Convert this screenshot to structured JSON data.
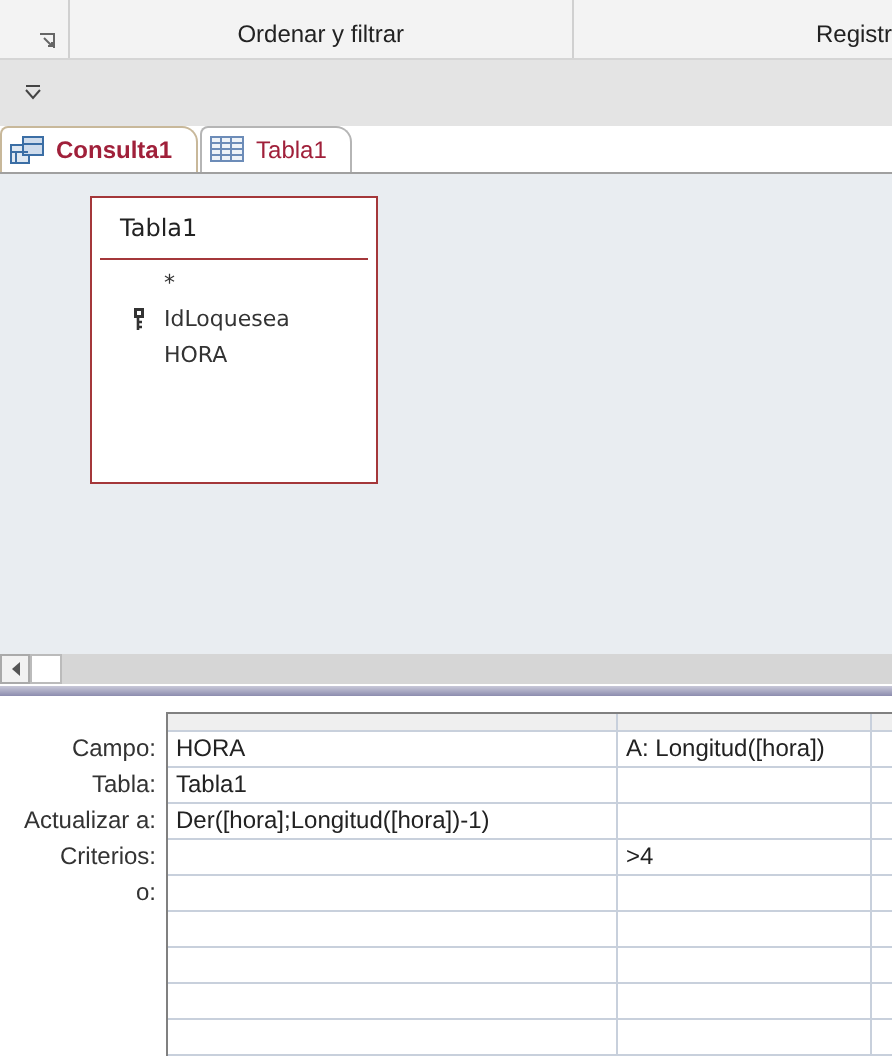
{
  "ribbon": {
    "groups": [
      {
        "label": "Ordenar y filtrar"
      },
      {
        "label": "Registr"
      }
    ]
  },
  "tabs": [
    {
      "label": "Consulta1",
      "kind": "query",
      "selected": true
    },
    {
      "label": "Tabla1",
      "kind": "table",
      "selected": false
    }
  ],
  "table_box": {
    "title": "Tabla1",
    "fields": [
      {
        "name": "*",
        "key": false
      },
      {
        "name": "IdLoquesea",
        "key": true
      },
      {
        "name": "HORA",
        "key": false
      }
    ]
  },
  "grid": {
    "rows": [
      {
        "label": "Campo:",
        "cells": [
          "HORA",
          "A: Longitud([hora])"
        ]
      },
      {
        "label": "Tabla:",
        "cells": [
          "Tabla1",
          null
        ]
      },
      {
        "label": "Actualizar a:",
        "cells": [
          "Der([hora];Longitud([hora])-1)",
          null
        ]
      },
      {
        "label": "Criterios:",
        "cells": [
          null,
          ">4"
        ]
      },
      {
        "label": "o:",
        "cells": [
          null,
          null
        ]
      }
    ]
  }
}
